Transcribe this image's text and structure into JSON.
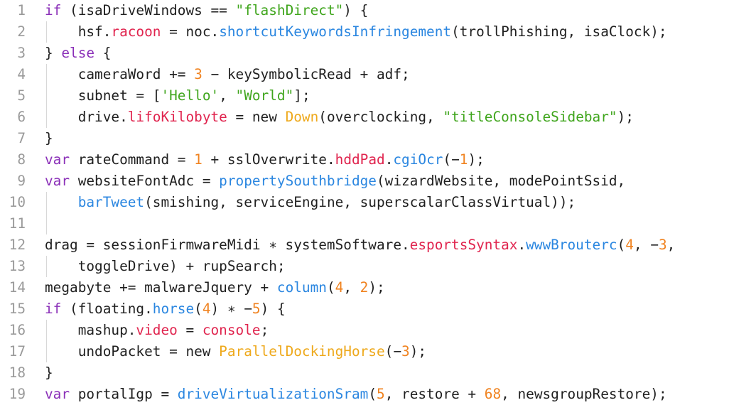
{
  "editor": {
    "colors": {
      "background": "#ffffff",
      "text": "#1f1f1f",
      "line_number": "#9a9a9a",
      "keyword": "#8a2fb8",
      "string": "#3fa51c",
      "number": "#f08320",
      "function": "#2a86e0",
      "property": "#e0244e",
      "class": "#eea81a",
      "indent_guide": "#d8d8d8"
    },
    "lines": [
      {
        "number": "1",
        "tokens": [
          [
            "kw",
            "if"
          ],
          [
            "id",
            " (isaDriveWindows == "
          ],
          [
            "str",
            "\"flashDirect\""
          ],
          [
            "id",
            ") {"
          ]
        ]
      },
      {
        "number": "2",
        "tokens": [
          [
            "id",
            "    hsf."
          ],
          [
            "prop",
            "racoon"
          ],
          [
            "id",
            " = noc."
          ],
          [
            "fn",
            "shortcutKeywordsInfringement"
          ],
          [
            "id",
            "(trollPhishing, isaClock);"
          ]
        ]
      },
      {
        "number": "3",
        "tokens": [
          [
            "id",
            "} "
          ],
          [
            "kw",
            "else"
          ],
          [
            "id",
            " {"
          ]
        ]
      },
      {
        "number": "4",
        "tokens": [
          [
            "id",
            "    cameraWord += "
          ],
          [
            "num",
            "3"
          ],
          [
            "id",
            " − keySymbolicRead + adf;"
          ]
        ]
      },
      {
        "number": "5",
        "tokens": [
          [
            "id",
            "    subnet = ["
          ],
          [
            "str",
            "'Hello'"
          ],
          [
            "id",
            ", "
          ],
          [
            "str",
            "\"World\""
          ],
          [
            "id",
            "];"
          ]
        ]
      },
      {
        "number": "6",
        "tokens": [
          [
            "id",
            "    drive."
          ],
          [
            "prop",
            "lifoKilobyte"
          ],
          [
            "id",
            " = new "
          ],
          [
            "cls",
            "Down"
          ],
          [
            "id",
            "(overclocking, "
          ],
          [
            "str",
            "\"titleConsoleSidebar\""
          ],
          [
            "id",
            ");"
          ]
        ]
      },
      {
        "number": "7",
        "tokens": [
          [
            "id",
            "}"
          ]
        ]
      },
      {
        "number": "8",
        "tokens": [
          [
            "kw",
            "var"
          ],
          [
            "id",
            " rateCommand = "
          ],
          [
            "num",
            "1"
          ],
          [
            "id",
            " + sslOverwrite."
          ],
          [
            "prop",
            "hddPad"
          ],
          [
            "id",
            "."
          ],
          [
            "fn",
            "cgiOcr"
          ],
          [
            "id",
            "(−"
          ],
          [
            "num",
            "1"
          ],
          [
            "id",
            ");"
          ]
        ]
      },
      {
        "number": "9",
        "tokens": [
          [
            "kw",
            "var"
          ],
          [
            "id",
            " websiteFontAdc = "
          ],
          [
            "fn",
            "propertySouthbridge"
          ],
          [
            "id",
            "(wizardWebsite, modePointSsid,"
          ]
        ]
      },
      {
        "number": "10",
        "tokens": [
          [
            "id",
            "    "
          ],
          [
            "fn",
            "barTweet"
          ],
          [
            "id",
            "(smishing, serviceEngine, superscalarClassVirtual));"
          ]
        ]
      },
      {
        "number": "11",
        "tokens": []
      },
      {
        "number": "12",
        "tokens": [
          [
            "id",
            "drag = sessionFirmwareMidi ∗ systemSoftware."
          ],
          [
            "prop",
            "esportsSyntax"
          ],
          [
            "id",
            "."
          ],
          [
            "fn",
            "wwwBrouterc"
          ],
          [
            "id",
            "("
          ],
          [
            "num",
            "4"
          ],
          [
            "id",
            ", −"
          ],
          [
            "num",
            "3"
          ],
          [
            "id",
            ","
          ]
        ]
      },
      {
        "number": "13",
        "tokens": [
          [
            "id",
            "    toggleDrive) + rupSearch;"
          ]
        ]
      },
      {
        "number": "14",
        "tokens": [
          [
            "id",
            "megabyte += malwareJquery + "
          ],
          [
            "fn",
            "column"
          ],
          [
            "id",
            "("
          ],
          [
            "num",
            "4"
          ],
          [
            "id",
            ", "
          ],
          [
            "num",
            "2"
          ],
          [
            "id",
            ");"
          ]
        ]
      },
      {
        "number": "15",
        "tokens": [
          [
            "kw",
            "if"
          ],
          [
            "id",
            " (floating."
          ],
          [
            "fn",
            "horse"
          ],
          [
            "id",
            "("
          ],
          [
            "num",
            "4"
          ],
          [
            "id",
            ") ∗ −"
          ],
          [
            "num",
            "5"
          ],
          [
            "id",
            ") {"
          ]
        ]
      },
      {
        "number": "16",
        "tokens": [
          [
            "id",
            "    mashup."
          ],
          [
            "prop",
            "video"
          ],
          [
            "id",
            " = "
          ],
          [
            "prop",
            "console"
          ],
          [
            "id",
            ";"
          ]
        ]
      },
      {
        "number": "17",
        "tokens": [
          [
            "id",
            "    undoPacket = new "
          ],
          [
            "cls",
            "ParallelDockingHorse"
          ],
          [
            "id",
            "(−"
          ],
          [
            "num",
            "3"
          ],
          [
            "id",
            ");"
          ]
        ]
      },
      {
        "number": "18",
        "tokens": [
          [
            "id",
            "}"
          ]
        ]
      },
      {
        "number": "19",
        "tokens": [
          [
            "kw",
            "var"
          ],
          [
            "id",
            " portalIgp = "
          ],
          [
            "fn",
            "driveVirtualizationSram"
          ],
          [
            "id",
            "("
          ],
          [
            "num",
            "5"
          ],
          [
            "id",
            ", restore + "
          ],
          [
            "num",
            "68"
          ],
          [
            "id",
            ", newsgroupRestore);"
          ]
        ]
      }
    ]
  }
}
